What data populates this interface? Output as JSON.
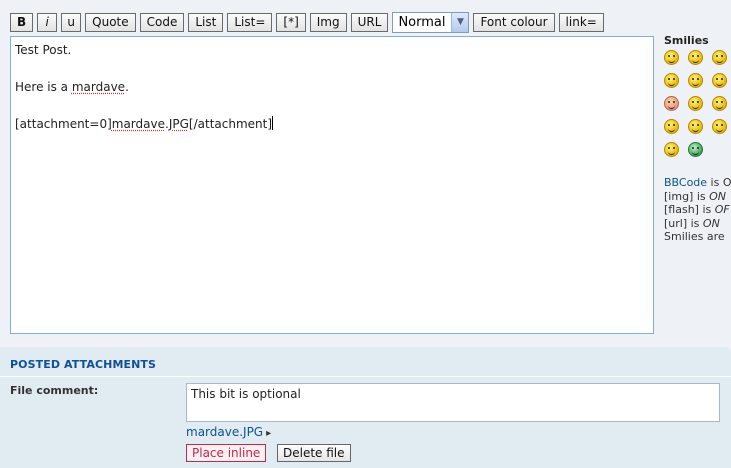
{
  "toolbar": {
    "buttons": [
      "B",
      "i",
      "u",
      "Quote",
      "Code",
      "List",
      "List=",
      "[*]",
      "Img",
      "URL"
    ],
    "font_size_select": "Normal",
    "font_colour_label": "Font colour",
    "link_label": "link="
  },
  "editor": {
    "line1": "Test Post.",
    "line2_prefix": "Here is a ",
    "line2_word": "mardave",
    "line2_suffix": ".",
    "line3_start": "[attachment=0]",
    "line3_word": "mardave",
    "line3_dot": ".",
    "line3_ext": "JPG",
    "line3_end": "[/attachment]"
  },
  "smilies": {
    "title": "Smilies",
    "icons": [
      "grin-icon",
      "smile-icon",
      "sad-icon",
      "smile-icon",
      "cool-icon",
      "laugh-icon",
      "embarrassed-icon",
      "confused-icon",
      "mad-icon",
      "wink-icon",
      "exclaim-icon",
      "question-icon",
      "neutral-icon",
      "green-grin-icon"
    ]
  },
  "bbinfo": {
    "bbcode_link": "BBCode",
    "bbcode_text": " is O",
    "img_text": "[img] is ",
    "img_state": "ON",
    "flash_text": "[flash] is ",
    "flash_state": "OF",
    "url_text": "[url] is ",
    "url_state": "ON",
    "smilies_text": "Smilies are"
  },
  "attachments": {
    "title": "POSTED ATTACHMENTS",
    "file_comment_label": "File comment:",
    "comment_value": "This bit is optional",
    "filename": "mardave.JPG",
    "place_inline": "Place inline",
    "delete_file": "Delete file"
  }
}
